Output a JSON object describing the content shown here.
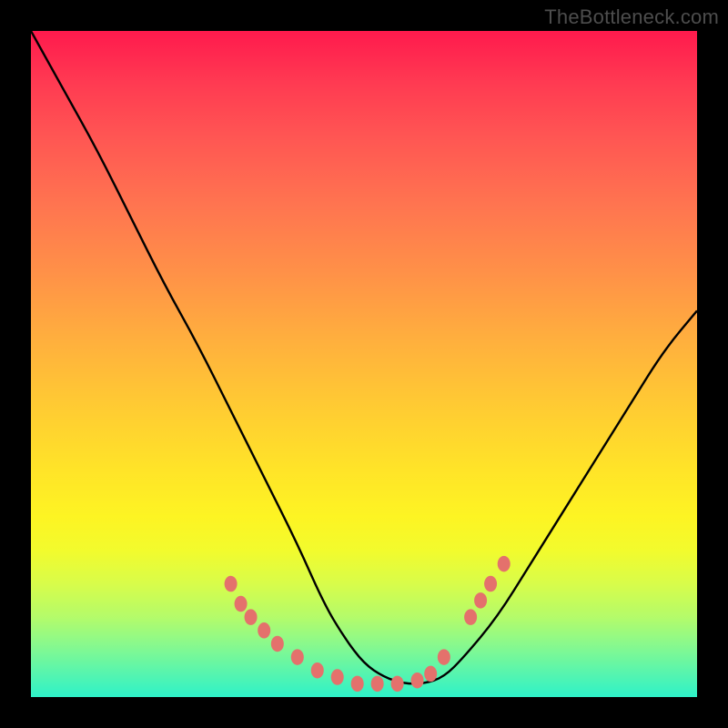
{
  "watermark": "TheBottleneck.com",
  "chart_data": {
    "type": "line",
    "title": "",
    "xlabel": "",
    "ylabel": "",
    "xlim": [
      0,
      100
    ],
    "ylim": [
      0,
      100
    ],
    "grid": false,
    "legend": false,
    "series": [
      {
        "name": "curve",
        "x": [
          0,
          5,
          10,
          15,
          20,
          25,
          30,
          35,
          40,
          44,
          47,
          50,
          53,
          56,
          59,
          62,
          65,
          70,
          75,
          80,
          85,
          90,
          95,
          100
        ],
        "y": [
          100,
          91,
          82,
          72,
          62,
          53,
          43,
          33,
          23,
          14,
          9,
          5,
          3,
          2,
          2,
          3,
          6,
          12,
          20,
          28,
          36,
          44,
          52,
          58
        ]
      }
    ],
    "markers": [
      {
        "x": 30,
        "y": 17
      },
      {
        "x": 31.5,
        "y": 14
      },
      {
        "x": 33,
        "y": 12
      },
      {
        "x": 35,
        "y": 10
      },
      {
        "x": 37,
        "y": 8
      },
      {
        "x": 40,
        "y": 6
      },
      {
        "x": 43,
        "y": 4
      },
      {
        "x": 46,
        "y": 3
      },
      {
        "x": 49,
        "y": 2
      },
      {
        "x": 52,
        "y": 2
      },
      {
        "x": 55,
        "y": 2
      },
      {
        "x": 58,
        "y": 2.5
      },
      {
        "x": 60,
        "y": 3.5
      },
      {
        "x": 62,
        "y": 6
      },
      {
        "x": 66,
        "y": 12
      },
      {
        "x": 67.5,
        "y": 14.5
      },
      {
        "x": 69,
        "y": 17
      },
      {
        "x": 71,
        "y": 20
      }
    ],
    "marker_style": {
      "color": "#e4716c",
      "radius_px": 7
    }
  }
}
